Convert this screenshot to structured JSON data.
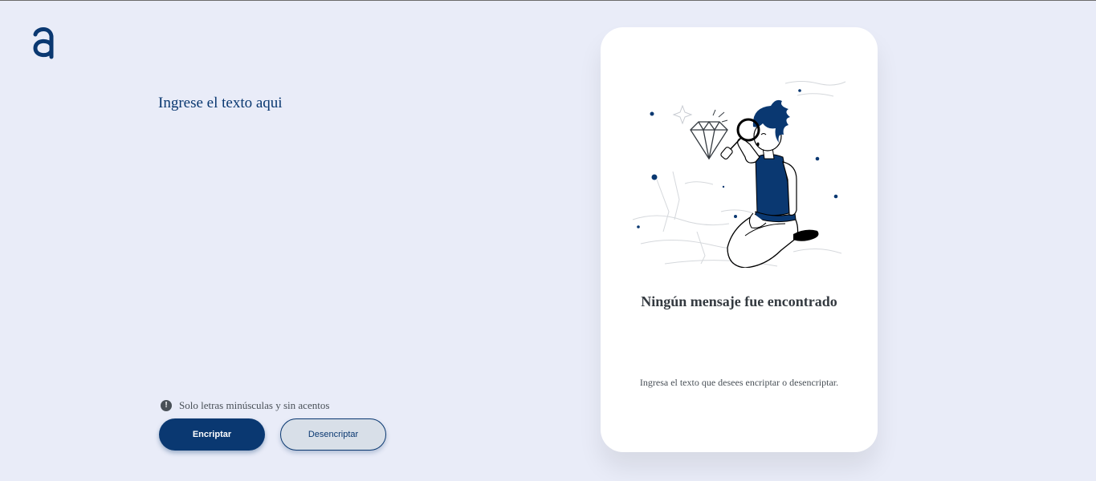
{
  "colors": {
    "background": "#e9ecf8",
    "accent": "#0a3871",
    "card": "#ffffff",
    "text_dark": "#343a40",
    "text_muted": "#495057"
  },
  "header": {
    "logo_icon": "alura-a-logo-icon"
  },
  "editor": {
    "placeholder": "Ingrese el texto aqui",
    "value": ""
  },
  "hint": {
    "icon": "info-circle-icon",
    "icon_glyph": "!",
    "text": "Solo letras minúsculas y sin acentos"
  },
  "buttons": {
    "encrypt_label": "Encriptar",
    "decrypt_label": "Desencriptar"
  },
  "output_card": {
    "illustration": "person-with-magnifying-glass-illustration",
    "title": "Ningún mensaje fue encontrado",
    "message": "Ingresa el texto que desees encriptar o desencriptar."
  }
}
